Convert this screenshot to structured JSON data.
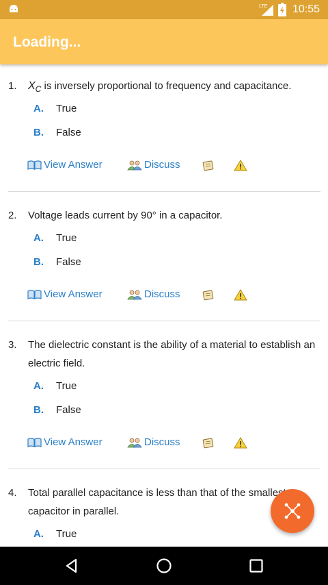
{
  "status_bar": {
    "time": "10:55",
    "network_label": "LTE",
    "icons": [
      "android-notification-icon",
      "lte-signal-icon",
      "battery-charging-icon"
    ]
  },
  "app_bar": {
    "title": "Loading..."
  },
  "actions": {
    "view_answer": "View Answer",
    "discuss": "Discuss"
  },
  "questions": [
    {
      "number": "1.",
      "symbol": "X",
      "symbol_sub": "C",
      "text": " is inversely proportional to frequency and capacitance.",
      "options": [
        {
          "letter": "A.",
          "text": "True"
        },
        {
          "letter": "B.",
          "text": "False"
        }
      ]
    },
    {
      "number": "2.",
      "text": "Voltage leads current by 90° in a capacitor.",
      "options": [
        {
          "letter": "A.",
          "text": "True"
        },
        {
          "letter": "B.",
          "text": "False"
        }
      ]
    },
    {
      "number": "3.",
      "text": "The dielectric constant is the ability of a material to establish an electric field.",
      "options": [
        {
          "letter": "A.",
          "text": "True"
        },
        {
          "letter": "B.",
          "text": "False"
        }
      ]
    },
    {
      "number": "4.",
      "text": "Total parallel capacitance is less than that of the smallest capacitor in parallel.",
      "options": [
        {
          "letter": "A.",
          "text": "True"
        }
      ]
    }
  ],
  "colors": {
    "status_bar": "#dea232",
    "app_bar": "#fdc65a",
    "link": "#2a7fc7",
    "fab": "#f26a2c",
    "nav_bar": "#000000"
  }
}
